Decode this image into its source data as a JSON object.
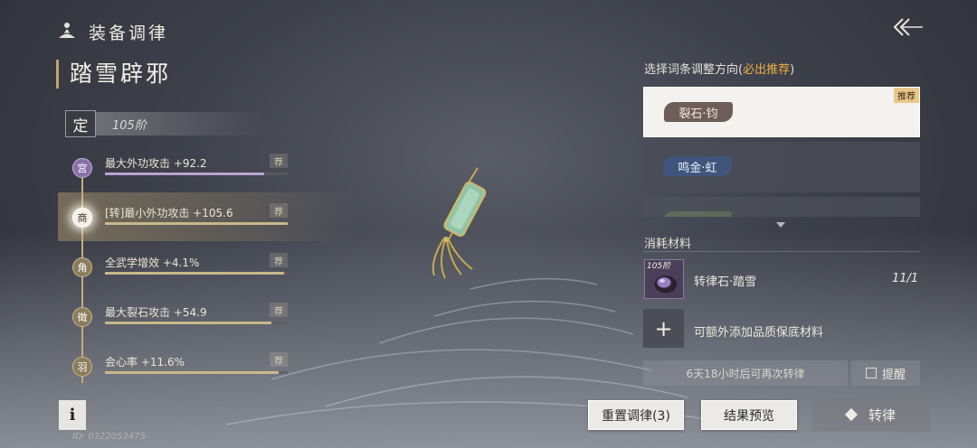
{
  "header": {
    "title": "装备调律"
  },
  "equipment": {
    "name": "踏雪辟邪"
  },
  "tier": {
    "badge": "定",
    "text": "105阶"
  },
  "stats": [
    {
      "node": "宫",
      "label": "最大外功攻击 +92.2",
      "rec": "荐",
      "fill": 0.87,
      "style": "purple",
      "active": false
    },
    {
      "node": "商",
      "label": "[转]最小外功攻击 +105.6",
      "rec": "荐",
      "fill": 1.0,
      "style": "glow",
      "active": true
    },
    {
      "node": "角",
      "label": "全武学增效 +4.1%",
      "rec": "荐",
      "fill": 0.98,
      "style": "gold",
      "active": false
    },
    {
      "node": "徵",
      "label": "最大裂石攻击 +54.9",
      "rec": "荐",
      "fill": 0.91,
      "style": "gold",
      "active": false
    },
    {
      "node": "羽",
      "label": "会心率 +11.6%",
      "rec": "荐",
      "fill": 0.95,
      "style": "gold",
      "active": false
    }
  ],
  "info_button": {
    "label": "i"
  },
  "player_id": "ID: 0322053475",
  "right": {
    "direction_label": "选择词条调整方向(",
    "direction_hint": "必出推荐",
    "direction_close": ")",
    "options": [
      {
        "label": "裂石·钧",
        "tag": "推荐"
      },
      {
        "label": "鸣金·虹"
      },
      {
        "label": ""
      }
    ],
    "materials_label": "消耗材料",
    "material": {
      "tier": "105阶",
      "name": "转律石·踏雪",
      "count": "11/1"
    },
    "add_label": "可额外添加品质保底材料",
    "cooldown": "6天18小时后可再次转律",
    "remind": "提醒"
  },
  "buttons": {
    "reset": "重置调律(3)",
    "preview": "结果预览",
    "transfer": "转律"
  }
}
